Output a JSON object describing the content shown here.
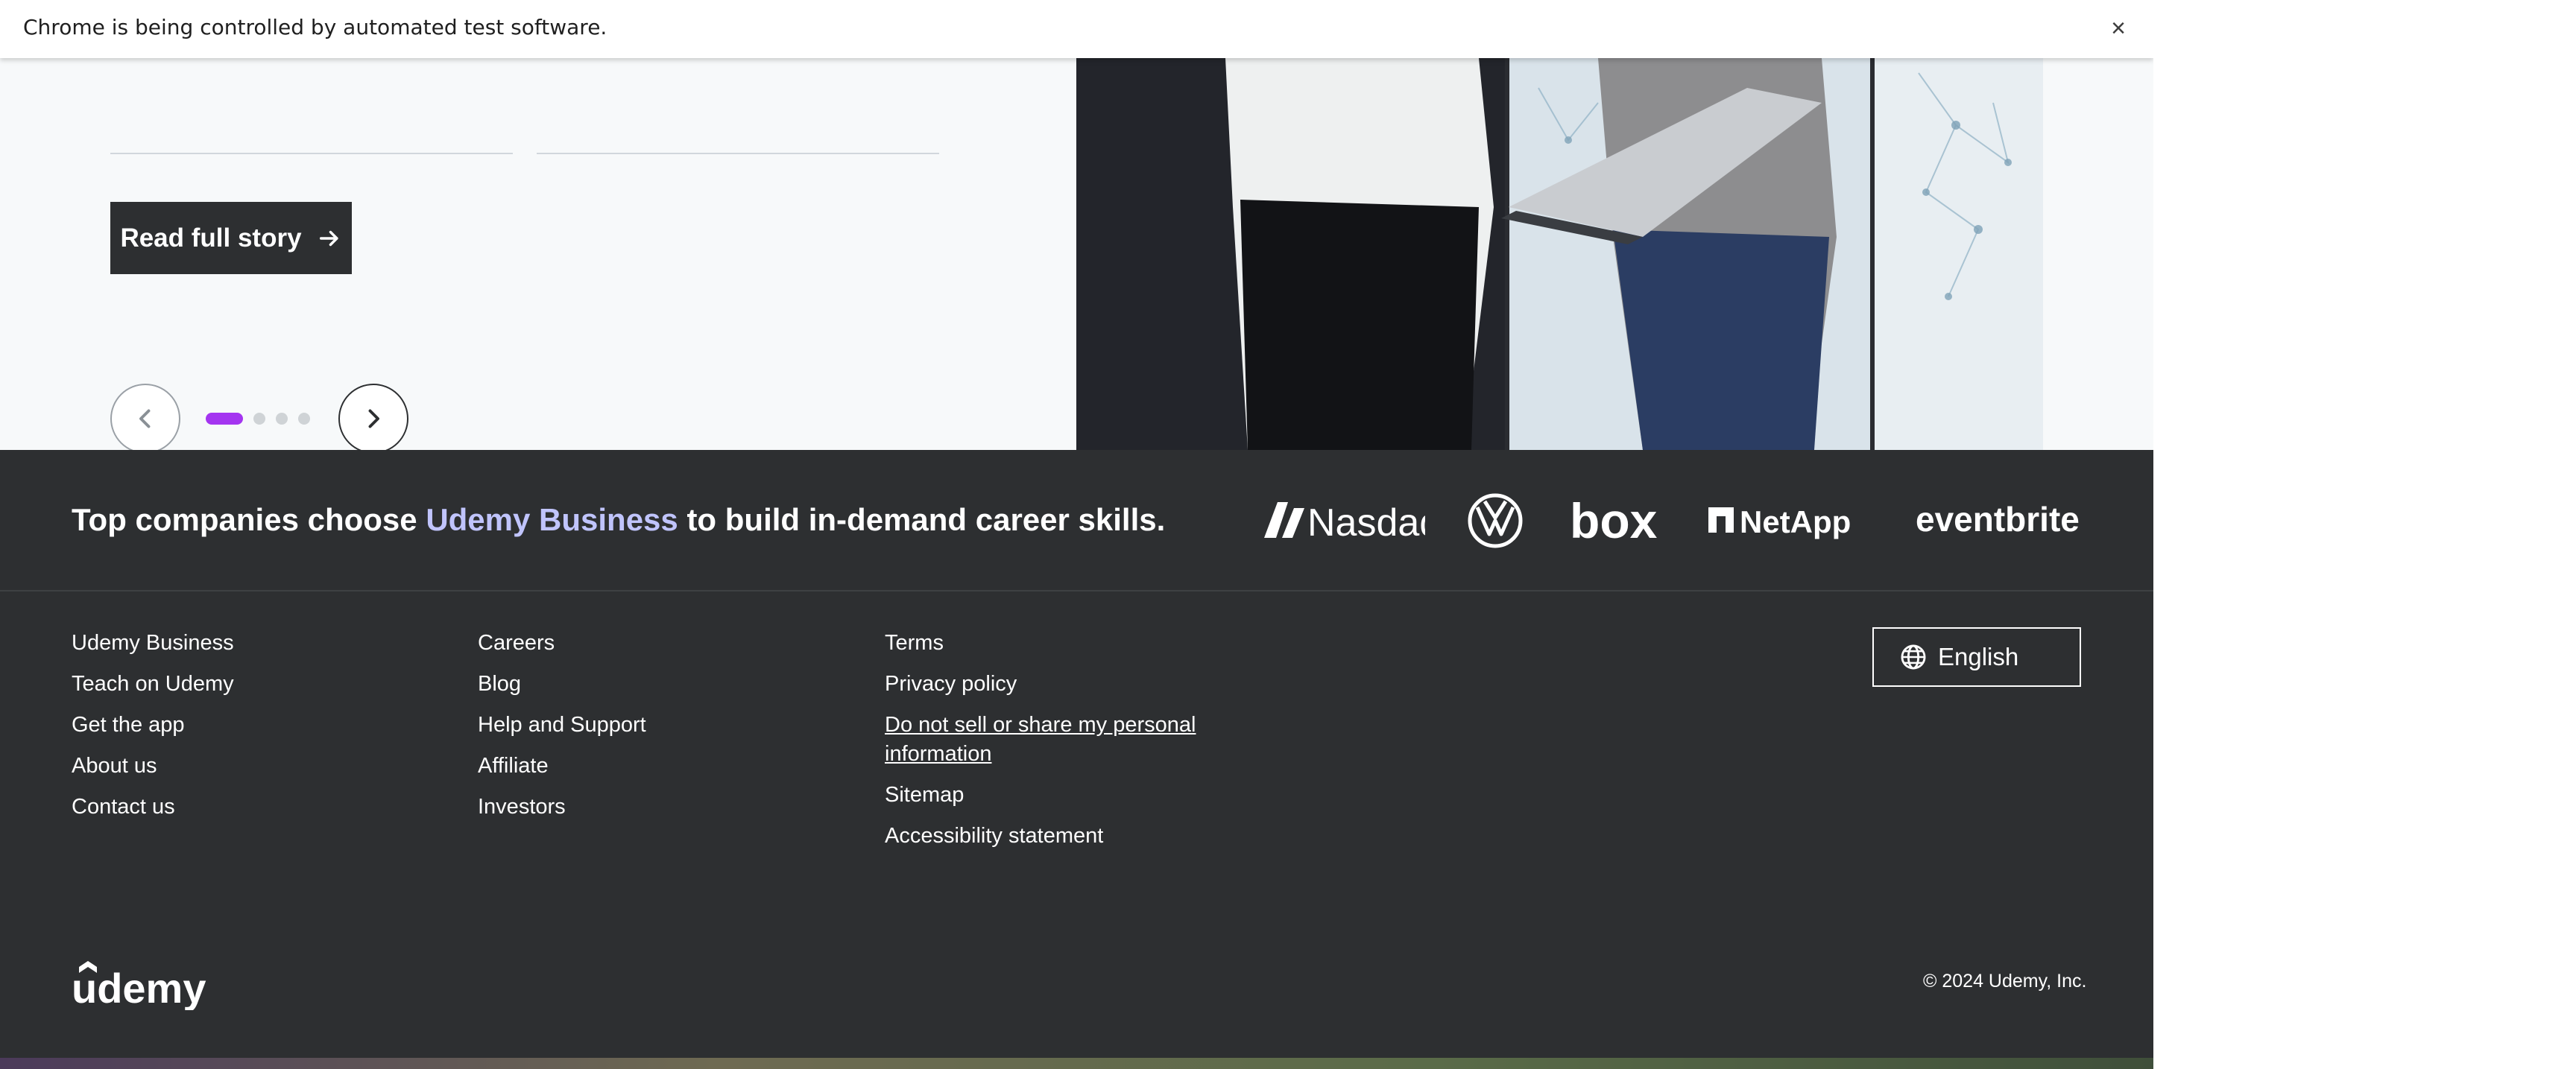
{
  "infobar": {
    "message": "Chrome is being controlled by automated test software.",
    "close_glyph": "×"
  },
  "story": {
    "read_button_label": "Read full story",
    "carousel": {
      "total_slides": 4,
      "active_slide": 1
    }
  },
  "companies": {
    "prefix": "Top companies choose ",
    "highlight": "Udemy Business",
    "suffix": " to build in-demand career skills.",
    "logos": [
      "Nasdaq",
      "Volkswagen",
      "box",
      "NetApp",
      "eventbrite"
    ]
  },
  "footer": {
    "col1": [
      "Udemy Business",
      "Teach on Udemy",
      "Get the app",
      "About us",
      "Contact us"
    ],
    "col2": [
      "Careers",
      "Blog",
      "Help and Support",
      "Affiliate",
      "Investors"
    ],
    "col3": [
      "Terms",
      "Privacy policy",
      "Do not sell or share my personal information",
      "Sitemap",
      "Accessibility statement"
    ],
    "language": "English",
    "brand": "udemy",
    "copyright": "© 2024 Udemy, Inc."
  },
  "colors": {
    "footer_bg": "#2d2f31",
    "accent_purple": "#a435f0",
    "highlight_lilac": "#c0c4fc"
  }
}
